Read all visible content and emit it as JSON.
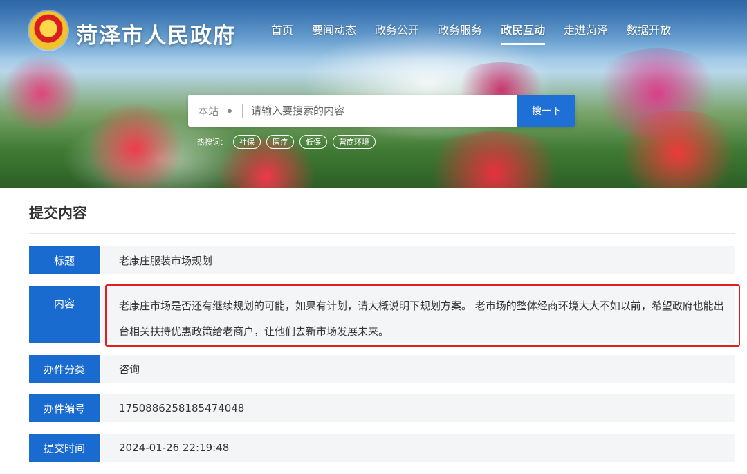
{
  "header": {
    "site_title": "菏泽市人民政府",
    "nav": [
      "首页",
      "要闻动态",
      "政务公开",
      "政务服务",
      "政民互动",
      "走进菏泽",
      "数据开放"
    ],
    "active_nav": "政民互动"
  },
  "search": {
    "scope": "本站",
    "placeholder": "请输入要搜索的内容",
    "button": "搜一下",
    "hot_label": "热搜词：",
    "hot_tags": [
      "社保",
      "医疗",
      "低保",
      "营商环境"
    ]
  },
  "content": {
    "section_title": "提交内容",
    "rows": [
      {
        "label": "标题",
        "value": "老康庄服装市场规划"
      },
      {
        "label": "内容",
        "value": "老康庄市场是否还有继续规划的可能，如果有计划，请大概说明下规划方案。 老市场的整体经商环境大大不如以前，希望政府也能出台相关扶持优惠政策给老商户，让他们去新市场发展未来。"
      },
      {
        "label": "办件分类",
        "value": "咨询"
      },
      {
        "label": "办件编号",
        "value": "1750886258185474048"
      },
      {
        "label": "提交时间",
        "value": "2024-01-26 22:19:48"
      }
    ]
  },
  "colors": {
    "label_bg": "#1a6bd0",
    "value_bg": "#f4f5f7",
    "search_button": "#1e6fd6",
    "highlight_border": "#e02020"
  }
}
